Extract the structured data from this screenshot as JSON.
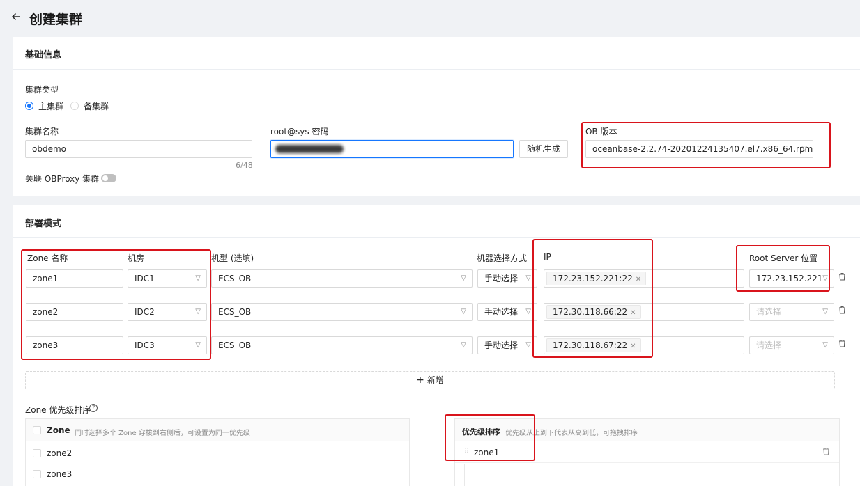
{
  "page": {
    "title": "创建集群"
  },
  "basic": {
    "title": "基础信息",
    "cluster_type_label": "集群类型",
    "primary_label": "主集群",
    "standby_label": "备集群",
    "cluster_name_label": "集群名称",
    "cluster_name_value": "obdemo",
    "cluster_name_count": "6/48",
    "password_label": "root@sys 密码",
    "random_button": "随机生成",
    "ob_version_label": "OB 版本",
    "ob_version_value": "oceanbase-2.2.74-20201224135407.el7.x86_64.rpm",
    "obproxy_label": "关联 OBProxy 集群"
  },
  "deploy": {
    "title": "部署模式",
    "headers": {
      "zone": "Zone 名称",
      "idc": "机房",
      "machine_type": "机型 (选填)",
      "select_mode": "机器选择方式",
      "ip": "IP",
      "root_server": "Root Server 位置"
    },
    "rows": [
      {
        "zone": "zone1",
        "idc": "IDC1",
        "machine_type": "ECS_OB",
        "select_mode": "手动选择",
        "ip": "172.23.152.221:22",
        "root_server": "172.23.152.221",
        "root_placeholder": false
      },
      {
        "zone": "zone2",
        "idc": "IDC2",
        "machine_type": "ECS_OB",
        "select_mode": "手动选择",
        "ip": "172.30.118.66:22",
        "root_server": "请选择",
        "root_placeholder": true
      },
      {
        "zone": "zone3",
        "idc": "IDC3",
        "machine_type": "ECS_OB",
        "select_mode": "手动选择",
        "ip": "172.30.118.67:22",
        "root_server": "请选择",
        "root_placeholder": true
      }
    ],
    "add_button": "新增",
    "priority_label": "Zone 优先级排序",
    "left_panel": {
      "header": "Zone",
      "hint": "同时选择多个 Zone 穿梭到右侧后，可设置为同一优先级",
      "items": [
        "zone2",
        "zone3"
      ]
    },
    "right_panel": {
      "header": "优先级排序",
      "hint": "优先级从上到下代表从高到低，可拖拽排序",
      "items": [
        "zone1"
      ]
    }
  },
  "icons": {
    "back": "arrow-left-icon",
    "chevron": "chevron-down-icon",
    "delete": "trash-icon",
    "help": "question-circle-icon",
    "close": "close-icon",
    "plus": "plus-icon",
    "drag": "drag-handle-icon"
  },
  "colors": {
    "primary": "#1677ff",
    "highlight": "#d9141c",
    "background": "#f0f2f5"
  }
}
